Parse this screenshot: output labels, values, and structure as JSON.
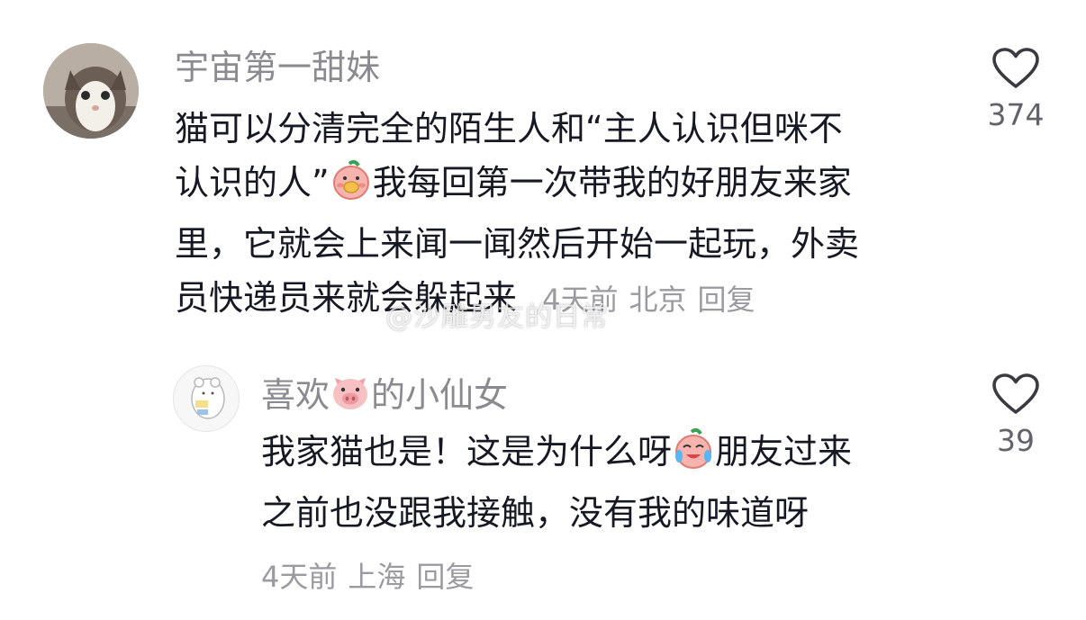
{
  "comments": [
    {
      "username": "宇宙第一甜妹",
      "lines": [
        "猫可以分清完全的陌生人和“主人认识但咪不",
        "认识的人”",
        "我每回第一次带我的好朋友来家",
        "里，它就会上来闻一闻然后开始一起玩，外卖",
        "员快递员来就会躲起来"
      ],
      "time": "4天前",
      "location": "北京",
      "reply_label": "回复",
      "likes": "374"
    },
    {
      "username_part1": "喜欢",
      "username_part2": "的小仙女",
      "lines": [
        "我家猫也是！这是为什么呀",
        "朋友过来",
        "之前也没跟我接触，没有我的味道呀"
      ],
      "time": "4天前",
      "location": "上海",
      "reply_label": "回复",
      "likes": "39"
    }
  ],
  "watermark": "@沙雕男友的日常",
  "icons": {
    "like": "heart-outline-icon",
    "emoji_1": "blushing-face-emoji",
    "emoji_2": "pig-face-emoji",
    "emoji_3": "crying-laughing-face-emoji"
  }
}
